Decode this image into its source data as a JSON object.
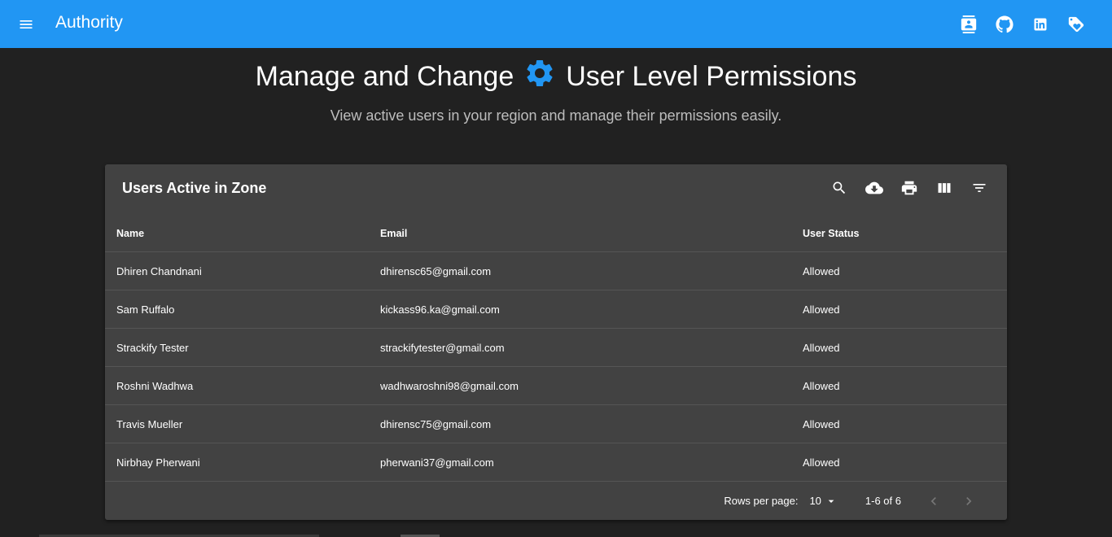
{
  "appbar": {
    "title": "Authority",
    "color": "#2196f3",
    "icons": [
      "contact-card-icon",
      "github-icon",
      "linkedin-icon",
      "tag-icon"
    ]
  },
  "hero": {
    "title_part1": "Manage and Change",
    "title_part2": "User Level Permissions",
    "subtitle": "View active users in your region and manage their permissions easily."
  },
  "table": {
    "title": "Users Active in Zone",
    "toolbar_icons": [
      "search-icon",
      "download-icon",
      "print-icon",
      "view-columns-icon",
      "filter-icon"
    ],
    "columns": [
      "Name",
      "Email",
      "User Status"
    ],
    "rows": [
      {
        "name": "Dhiren Chandnani",
        "email": "dhirensc65@gmail.com",
        "status": "Allowed"
      },
      {
        "name": "Sam Ruffalo",
        "email": "kickass96.ka@gmail.com",
        "status": "Allowed"
      },
      {
        "name": "Strackify Tester",
        "email": "strackifytester@gmail.com",
        "status": "Allowed"
      },
      {
        "name": "Roshni Wadhwa",
        "email": "wadhwaroshni98@gmail.com",
        "status": "Allowed"
      },
      {
        "name": "Travis Mueller",
        "email": "dhirensc75@gmail.com",
        "status": "Allowed"
      },
      {
        "name": "Nirbhay Pherwani",
        "email": "pherwani37@gmail.com",
        "status": "Allowed"
      }
    ],
    "pagination": {
      "rows_per_page_label": "Rows per page:",
      "rows_per_page": "10",
      "range": "1-6 of 6"
    }
  }
}
